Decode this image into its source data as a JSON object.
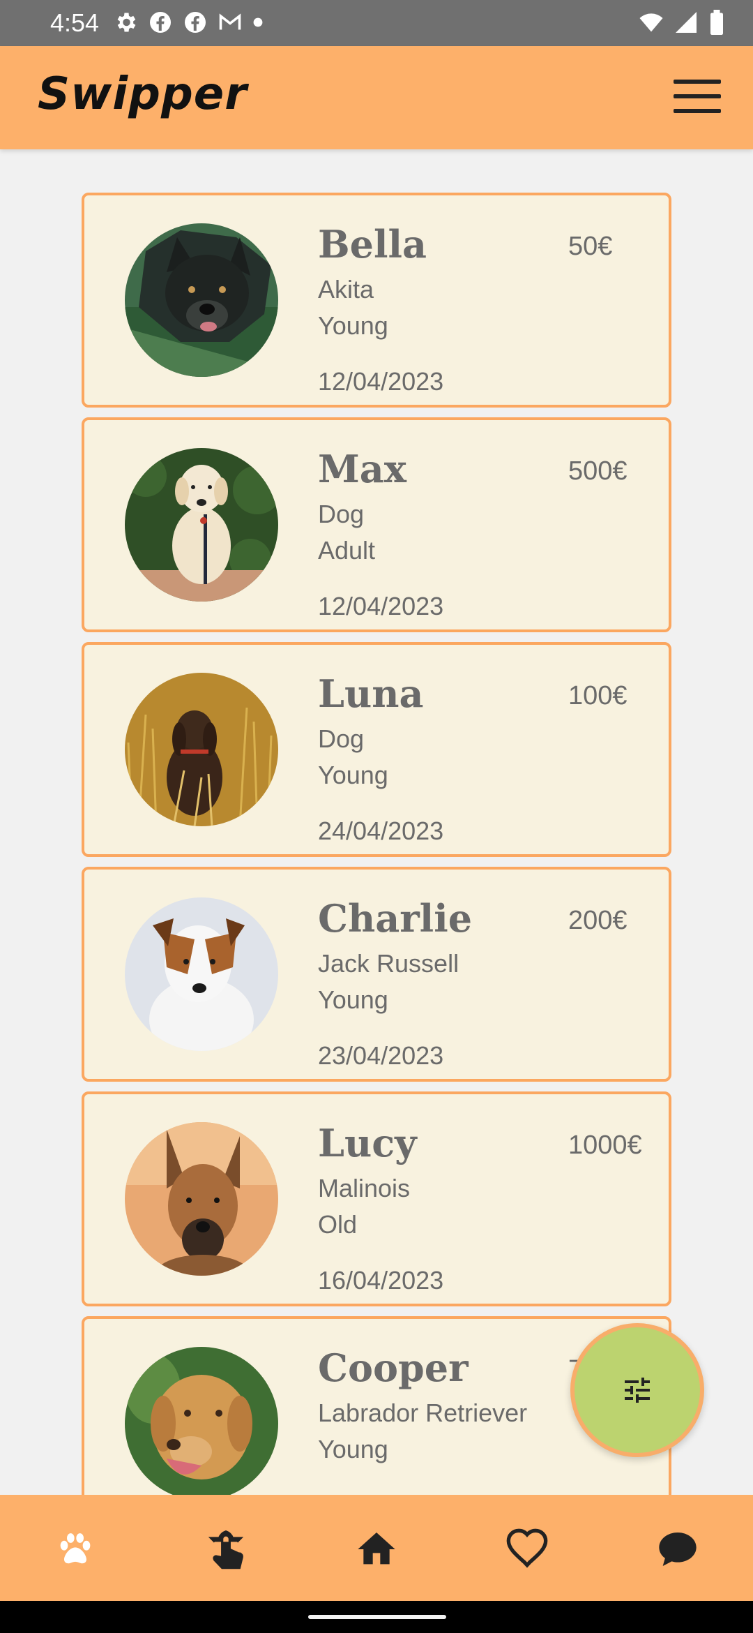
{
  "status_bar": {
    "time": "4:54",
    "left_icons": [
      "settings-icon",
      "facebook-icon",
      "facebook-icon",
      "gmail-icon",
      "dot-icon"
    ],
    "right_icons": [
      "wifi-icon",
      "signal-icon",
      "battery-icon"
    ]
  },
  "app_bar": {
    "title": "Swipper",
    "menu_icon": "hamburger-menu-icon"
  },
  "colors": {
    "app_bar": "#fdb06a",
    "card_background": "#f8f2df",
    "card_border": "#fba760",
    "fab": "#bcd36f",
    "text": "#6a6a6a"
  },
  "pets": [
    {
      "name": "Bella",
      "breed": "Akita",
      "age": "Young",
      "date": "12/04/2023",
      "price": "50€"
    },
    {
      "name": "Max",
      "breed": "Dog",
      "age": "Adult",
      "date": "12/04/2023",
      "price": "500€"
    },
    {
      "name": "Luna",
      "breed": "Dog",
      "age": "Young",
      "date": "24/04/2023",
      "price": "100€"
    },
    {
      "name": "Charlie",
      "breed": "Jack Russell",
      "age": "Young",
      "date": "23/04/2023",
      "price": "200€"
    },
    {
      "name": "Lucy",
      "breed": "Malinois",
      "age": "Old",
      "date": "16/04/2023",
      "price": "1000€"
    },
    {
      "name": "Cooper",
      "breed": "Labrador Retriever",
      "age": "Young",
      "date": "",
      "price": "7"
    }
  ],
  "fab": {
    "icon": "filter-sliders-icon"
  },
  "bottom_nav": {
    "items": [
      "paw-icon",
      "swipe-icon",
      "home-icon",
      "heart-icon",
      "chat-icon"
    ]
  }
}
